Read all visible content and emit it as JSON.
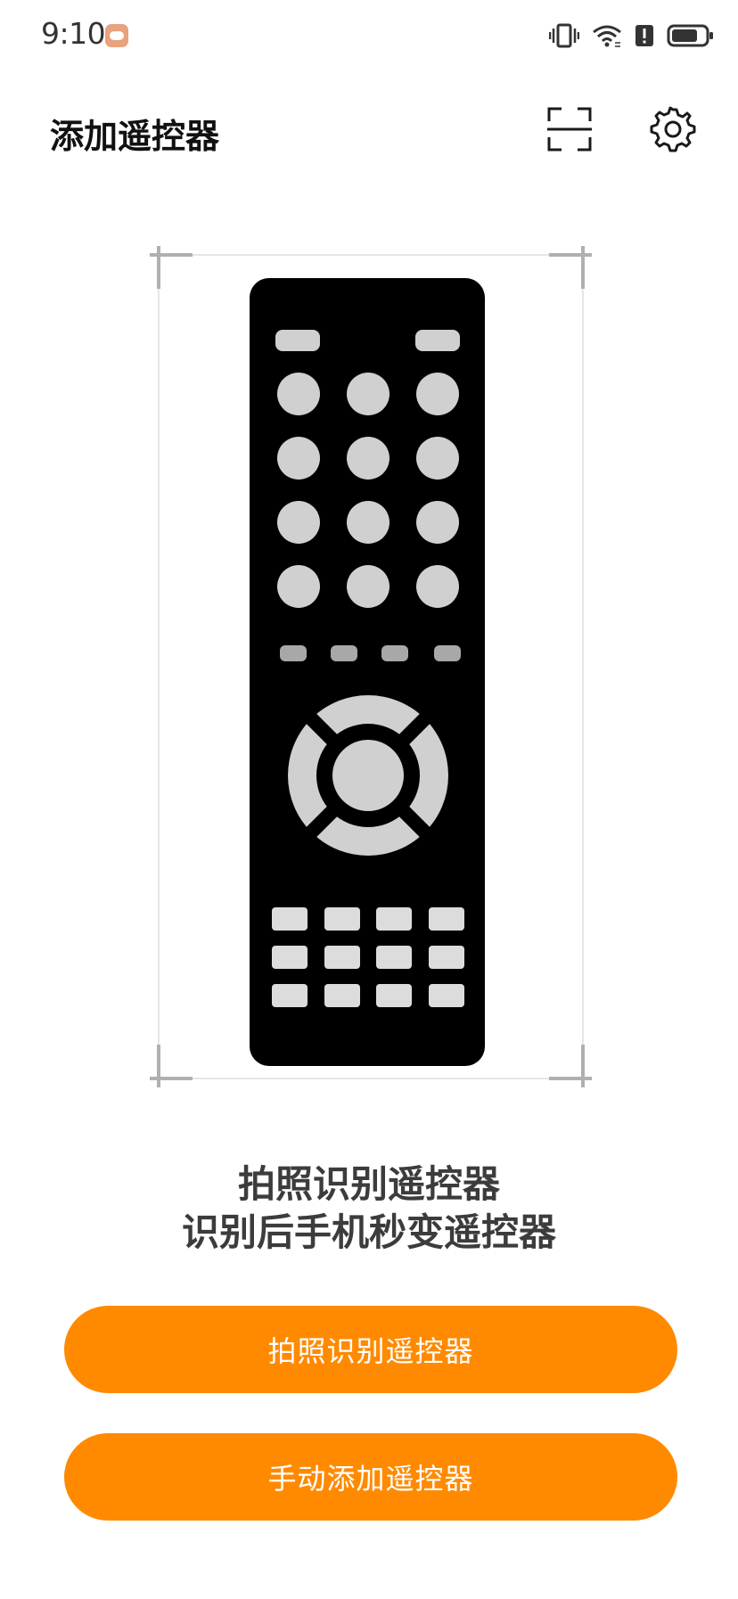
{
  "status_bar": {
    "time": "9:10",
    "notification_icon": "message-icon",
    "icons": [
      "vibrate-icon",
      "wifi-icon",
      "alert-icon",
      "battery-icon"
    ]
  },
  "app_bar": {
    "title": "添加遥控器",
    "actions": [
      "scan-icon",
      "gear-icon"
    ]
  },
  "illustration": {
    "icon": "remote-control-icon"
  },
  "caption": {
    "line1": "拍照识别遥控器",
    "line2": "识别后手机秒变遥控器"
  },
  "buttons": {
    "photo_label": "拍照识别遥控器",
    "manual_label": "手动添加遥控器"
  },
  "colors": {
    "accent": "#ff8a00",
    "remote_body": "#000000",
    "remote_keys": "#d0d0d0"
  }
}
